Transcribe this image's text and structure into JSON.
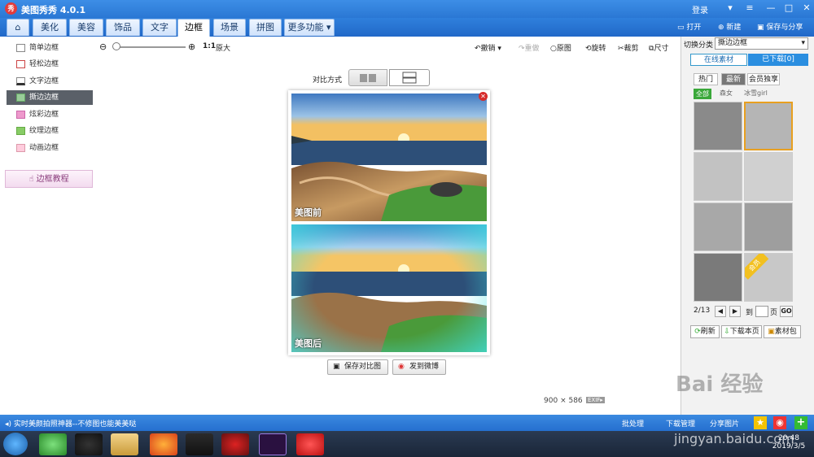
{
  "app": {
    "title": "美图秀秀 4.0.1",
    "logo_text": "秀",
    "login": "登录"
  },
  "tabs": [
    {
      "label": "⌂"
    },
    {
      "label": "美化"
    },
    {
      "label": "美容"
    },
    {
      "label": "饰品"
    },
    {
      "label": "文字"
    },
    {
      "label": "边框"
    },
    {
      "label": "场景"
    },
    {
      "label": "拼图"
    },
    {
      "label": "更多功能 ▾"
    }
  ],
  "actions": {
    "open": "打开",
    "new": "新建",
    "save_share": "保存与分享"
  },
  "left": {
    "items": [
      {
        "label": "简单边框"
      },
      {
        "label": "轻松边框"
      },
      {
        "label": "文字边框"
      },
      {
        "label": "撕边边框"
      },
      {
        "label": "炫彩边框"
      },
      {
        "label": "纹理边框"
      },
      {
        "label": "动画边框"
      }
    ],
    "tutorial": "边框教程"
  },
  "toolbar": {
    "zoom_one": "1:1",
    "original_size": "原大",
    "undo": "撤销",
    "redo": "重做",
    "original": "原图",
    "rotate": "旋转",
    "crop": "裁剪",
    "resize": "尺寸"
  },
  "compare": {
    "label": "对比方式"
  },
  "photos": {
    "before": "美图前",
    "after": "美图后"
  },
  "buttons": {
    "save_compare": "保存对比图",
    "send_weibo": "发到微博"
  },
  "image_info": {
    "width": "900",
    "x": "×",
    "height": "586",
    "exif": "EXIF▸"
  },
  "right": {
    "switch_label": "切换分类",
    "category": "撕边边框",
    "tab_online": "在线素材",
    "tab_downloaded": "已下载[0]",
    "subtabs": [
      "热门",
      "最新",
      "会员独享"
    ],
    "filters": [
      "全部",
      "森女",
      "冰雪girl"
    ],
    "page": "2/13",
    "goto_label": "到",
    "page_unit": "页",
    "go": "GO",
    "refresh": "刷新",
    "download_page": "下载本页",
    "material_pack": "素材包",
    "member_badge": "会员"
  },
  "statusbar": {
    "message": "实时美颜拍照神器--不修图也能美美哒",
    "batch": "批处理",
    "download_mgr": "下载管理",
    "share_img": "分享图片"
  },
  "taskbar": {
    "time": "20:48",
    "date": "2019/3/5"
  },
  "watermark": {
    "text": "Bai 经验",
    "url": "jingyan.baidu.com"
  }
}
